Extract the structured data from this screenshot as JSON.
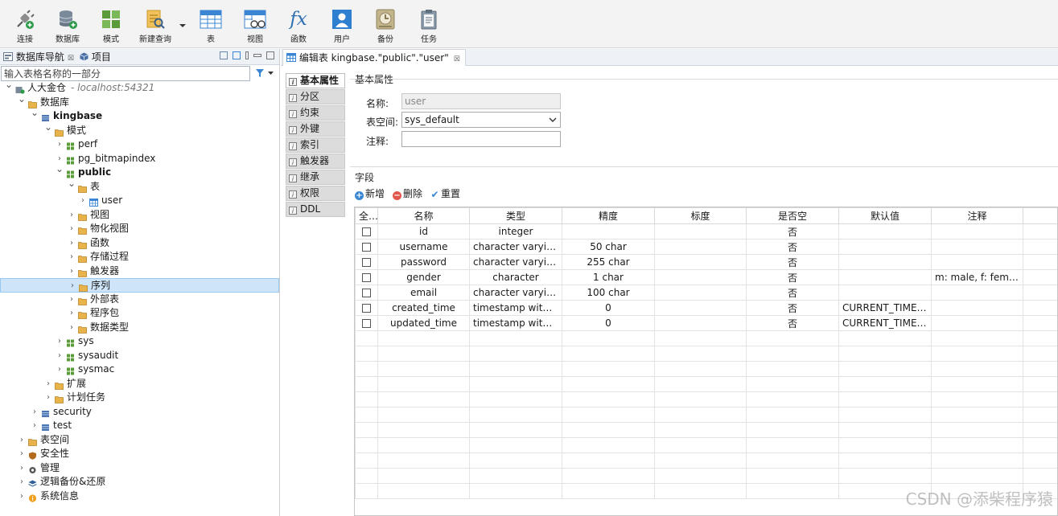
{
  "toolbar": {
    "buttons": [
      {
        "label": "连接",
        "icon": "plug-icon"
      },
      {
        "label": "数据库",
        "icon": "database-add-icon"
      },
      {
        "label": "模式",
        "icon": "schema-grid-icon"
      },
      {
        "label": "新建查询",
        "icon": "new-query-icon"
      },
      {
        "label": "表",
        "icon": "table-icon"
      },
      {
        "label": "视图",
        "icon": "view-glasses-icon"
      },
      {
        "label": "函数",
        "icon": "function-fx-icon"
      },
      {
        "label": "用户",
        "icon": "user-icon"
      },
      {
        "label": "备份",
        "icon": "backup-clock-icon"
      },
      {
        "label": "任务",
        "icon": "task-clipboard-icon"
      }
    ],
    "fx_glyph": "fx"
  },
  "left_panel": {
    "tab_navigator": "数据库导航",
    "tab_project": "项目",
    "close_glyph": "☒",
    "search_placeholder": "输入表格名称的一部分",
    "tree": [
      {
        "label": "人大金仓",
        "suffix": "- localhost:54321",
        "level": 0,
        "arrow": "expanded",
        "icon": "server-icon",
        "bold": false
      },
      {
        "label": "数据库",
        "level": 1,
        "arrow": "expanded",
        "icon": "folder-icon",
        "bold": false
      },
      {
        "label": "kingbase",
        "level": 2,
        "arrow": "expanded",
        "icon": "database-icon",
        "bold": true
      },
      {
        "label": "模式",
        "level": 3,
        "arrow": "expanded",
        "icon": "folder-icon",
        "bold": false
      },
      {
        "label": "perf",
        "level": 4,
        "arrow": "collapsed",
        "icon": "schema-icon",
        "bold": false
      },
      {
        "label": "pg_bitmapindex",
        "level": 4,
        "arrow": "collapsed",
        "icon": "schema-icon",
        "bold": false
      },
      {
        "label": "public",
        "level": 4,
        "arrow": "expanded",
        "icon": "schema-icon",
        "bold": true
      },
      {
        "label": "表",
        "level": 5,
        "arrow": "expanded",
        "icon": "folder-icon",
        "bold": false
      },
      {
        "label": "user",
        "level": 6,
        "arrow": "collapsed",
        "icon": "table-icon",
        "bold": false
      },
      {
        "label": "视图",
        "level": 5,
        "arrow": "collapsed",
        "icon": "folder-icon",
        "bold": false
      },
      {
        "label": "物化视图",
        "level": 5,
        "arrow": "collapsed",
        "icon": "folder-icon",
        "bold": false
      },
      {
        "label": "函数",
        "level": 5,
        "arrow": "collapsed",
        "icon": "folder-icon",
        "bold": false
      },
      {
        "label": "存储过程",
        "level": 5,
        "arrow": "collapsed",
        "icon": "folder-icon",
        "bold": false
      },
      {
        "label": "触发器",
        "level": 5,
        "arrow": "collapsed",
        "icon": "folder-icon",
        "bold": false
      },
      {
        "label": "序列",
        "level": 5,
        "arrow": "collapsed",
        "icon": "folder-icon",
        "bold": false,
        "selected": true
      },
      {
        "label": "外部表",
        "level": 5,
        "arrow": "collapsed",
        "icon": "folder-icon",
        "bold": false
      },
      {
        "label": "程序包",
        "level": 5,
        "arrow": "collapsed",
        "icon": "folder-icon",
        "bold": false
      },
      {
        "label": "数据类型",
        "level": 5,
        "arrow": "collapsed",
        "icon": "folder-icon",
        "bold": false
      },
      {
        "label": "sys",
        "level": 4,
        "arrow": "collapsed",
        "icon": "schema-icon",
        "bold": false
      },
      {
        "label": "sysaudit",
        "level": 4,
        "arrow": "collapsed",
        "icon": "schema-icon",
        "bold": false
      },
      {
        "label": "sysmac",
        "level": 4,
        "arrow": "collapsed",
        "icon": "schema-icon",
        "bold": false
      },
      {
        "label": "扩展",
        "level": 3,
        "arrow": "collapsed",
        "icon": "folder-icon",
        "bold": false
      },
      {
        "label": "计划任务",
        "level": 3,
        "arrow": "collapsed",
        "icon": "folder-icon",
        "bold": false
      },
      {
        "label": "security",
        "level": 2,
        "arrow": "collapsed",
        "icon": "database-icon",
        "bold": false
      },
      {
        "label": "test",
        "level": 2,
        "arrow": "collapsed",
        "icon": "database-icon",
        "bold": false
      },
      {
        "label": "表空间",
        "level": 1,
        "arrow": "collapsed",
        "icon": "folder-icon",
        "bold": false
      },
      {
        "label": "安全性",
        "level": 1,
        "arrow": "collapsed",
        "icon": "shield-icon",
        "bold": false
      },
      {
        "label": "管理",
        "level": 1,
        "arrow": "collapsed",
        "icon": "gear-icon",
        "bold": false
      },
      {
        "label": "逻辑备份&还原",
        "level": 1,
        "arrow": "collapsed",
        "icon": "layers-icon",
        "bold": false
      },
      {
        "label": "系统信息",
        "level": 1,
        "arrow": "collapsed",
        "icon": "info-icon",
        "bold": false
      }
    ]
  },
  "editor": {
    "tab_title": "编辑表 kingbase.\"public\".\"user\"",
    "close_glyph": "☒",
    "side_tabs": [
      "基本属性",
      "分区",
      "约束",
      "外键",
      "索引",
      "触发器",
      "继承",
      "权限",
      "DDL"
    ],
    "side_tab_icon_glyph": "i",
    "basic": {
      "section_title": "基本属性",
      "name_label": "名称:",
      "name_value": "user",
      "tablespace_label": "表空间:",
      "tablespace_value": "sys_default",
      "comment_label": "注释:",
      "comment_value": ""
    },
    "fields": {
      "section_title": "字段",
      "actions": [
        {
          "label": "新增",
          "icon": "add-circle-icon",
          "glyph": "+",
          "color": "#3a86d4"
        },
        {
          "label": "删除",
          "icon": "remove-circle-icon",
          "glyph": "−",
          "color": "#e2574c"
        },
        {
          "label": "重置",
          "icon": "reset-check-icon",
          "glyph": "✔",
          "color": "#3a86d4"
        }
      ],
      "columns": [
        "全..",
        "名称",
        "类型",
        "精度",
        "标度",
        "是否空",
        "默认值",
        "注释"
      ],
      "rows": [
        {
          "name": "id",
          "type": "integer",
          "precision": "",
          "scale": "",
          "nullable": "否",
          "default": "",
          "comment": ""
        },
        {
          "name": "username",
          "type": "character varying",
          "precision": "50 char",
          "scale": "",
          "nullable": "否",
          "default": "",
          "comment": ""
        },
        {
          "name": "password",
          "type": "character varying",
          "precision": "255 char",
          "scale": "",
          "nullable": "否",
          "default": "",
          "comment": ""
        },
        {
          "name": "gender",
          "type": "character",
          "precision": "1 char",
          "scale": "",
          "nullable": "否",
          "default": "",
          "comment": "m: male, f: femal..."
        },
        {
          "name": "email",
          "type": "character varying",
          "precision": "100 char",
          "scale": "",
          "nullable": "否",
          "default": "",
          "comment": ""
        },
        {
          "name": "created_time",
          "type": "timestamp with t...",
          "precision": "0",
          "scale": "",
          "nullable": "否",
          "default": "CURRENT_TIMES...",
          "comment": ""
        },
        {
          "name": "updated_time",
          "type": "timestamp with t...",
          "precision": "0",
          "scale": "",
          "nullable": "否",
          "default": "CURRENT_TIMES...",
          "comment": ""
        }
      ],
      "empty_rows": 11
    }
  },
  "watermark": "CSDN @添柴程序猿",
  "colors": {
    "accent": "#3a86d4",
    "folder": "#e8b34a",
    "selection": "#cde4f9",
    "schema": "#5a9b3a"
  }
}
